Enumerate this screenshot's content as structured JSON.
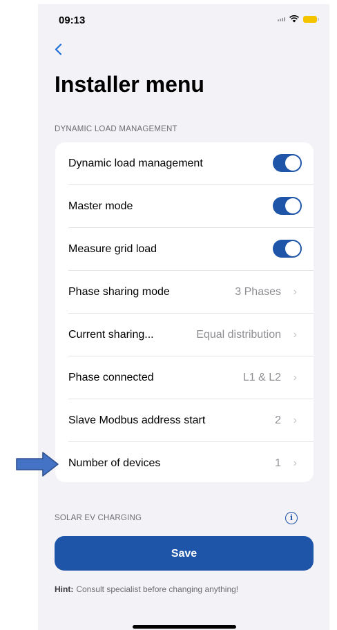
{
  "status_bar": {
    "time": "09:13"
  },
  "title": "Installer menu",
  "sections": [
    {
      "header": "DYNAMIC LOAD MANAGEMENT"
    },
    {
      "header": "SOLAR EV CHARGING"
    }
  ],
  "rows": [
    {
      "label": "Dynamic load management",
      "toggle": true
    },
    {
      "label": "Master mode",
      "toggle": true
    },
    {
      "label": "Measure grid load",
      "toggle": true
    },
    {
      "label": "Phase sharing mode",
      "value": "3 Phases"
    },
    {
      "label": "Current sharing...",
      "value": "Equal distribution"
    },
    {
      "label": "Phase connected",
      "value": "L1 & L2"
    },
    {
      "label": "Slave Modbus address start",
      "value": "2"
    },
    {
      "label": "Number of devices",
      "value": "1"
    }
  ],
  "save_label": "Save",
  "hint": {
    "label": "Hint:",
    "text": "Consult specialist before changing anything!"
  },
  "colors": {
    "accent": "#1e55a8",
    "back": "#1f6fd6",
    "background": "#f2f2f7",
    "arrow": "#4472c4"
  },
  "icons": {
    "back": "chevron-left-icon",
    "info": "info-icon",
    "chevron": "chevron-right-icon"
  }
}
